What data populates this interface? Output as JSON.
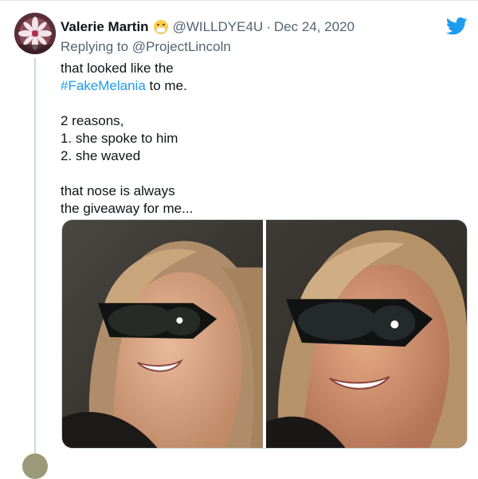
{
  "tweet": {
    "author_name": "Valerie Martin",
    "author_emoji": "face-with-medical-mask-emoji",
    "handle": "@WILLDYE4U",
    "separator": "·",
    "date": "Dec 24, 2020",
    "replying_prefix": "Replying to ",
    "replying_to": "@ProjectLincoln",
    "text": {
      "line1": "that looked like the",
      "hashtag": "#FakeMelania",
      "line2_rest": " to me.",
      "line3": "2 reasons,",
      "line4": "1. she spoke to him",
      "line5": "2. she waved",
      "line6": "that nose is always",
      "line7": "the giveaway for me..."
    },
    "media_count": 2
  },
  "icons": {
    "brand": "twitter-bird-icon",
    "brand_color": "#1d9bf0"
  }
}
